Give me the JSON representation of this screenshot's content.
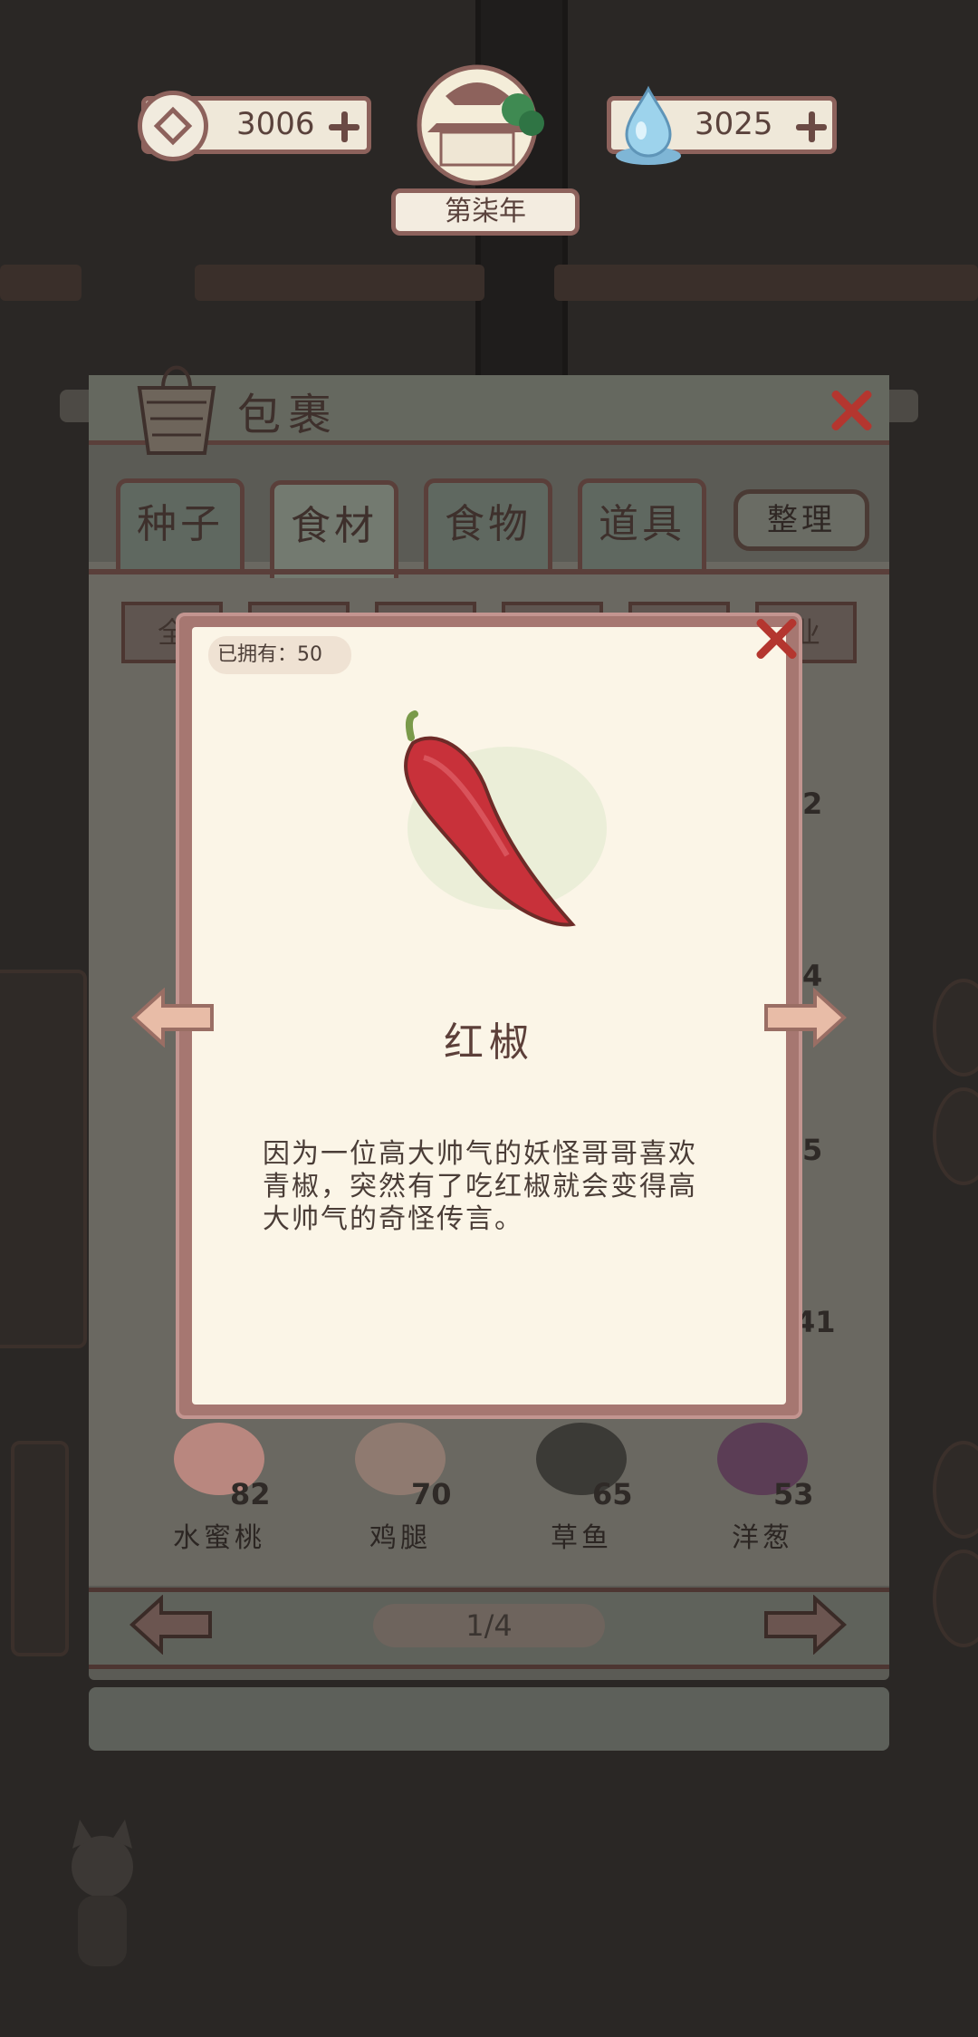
{
  "hud": {
    "coins": "3006",
    "spirit": "3025",
    "year_label": "第柒年"
  },
  "bag": {
    "title": "包裹",
    "tabs": [
      "种子",
      "食材",
      "食物",
      "道具"
    ],
    "active_tab": "食材",
    "sort_label": "整理",
    "subfilters": [
      "全",
      "",
      "",
      "",
      "",
      "业"
    ],
    "visible_items": [
      {
        "name": "水蜜桃",
        "count": "82"
      },
      {
        "name": "鸡腿",
        "count": "70"
      },
      {
        "name": "草鱼",
        "count": "65"
      },
      {
        "name": "洋葱",
        "count": "53"
      }
    ],
    "partially_hidden_counts": [
      "2",
      "4",
      "5",
      "41"
    ],
    "page": "1/4"
  },
  "modal": {
    "owned_label": "已拥有：50",
    "item_name": "红椒",
    "description": "因为一位高大帅气的妖怪哥哥喜欢青椒，突然有了吃红椒就会变得高大帅气的奇怪传言。"
  },
  "colors": {
    "modal_frame": "#a67771",
    "paper": "#fbf5e7",
    "close_red": "#b4362f",
    "pepper_red": "#c8313a"
  }
}
